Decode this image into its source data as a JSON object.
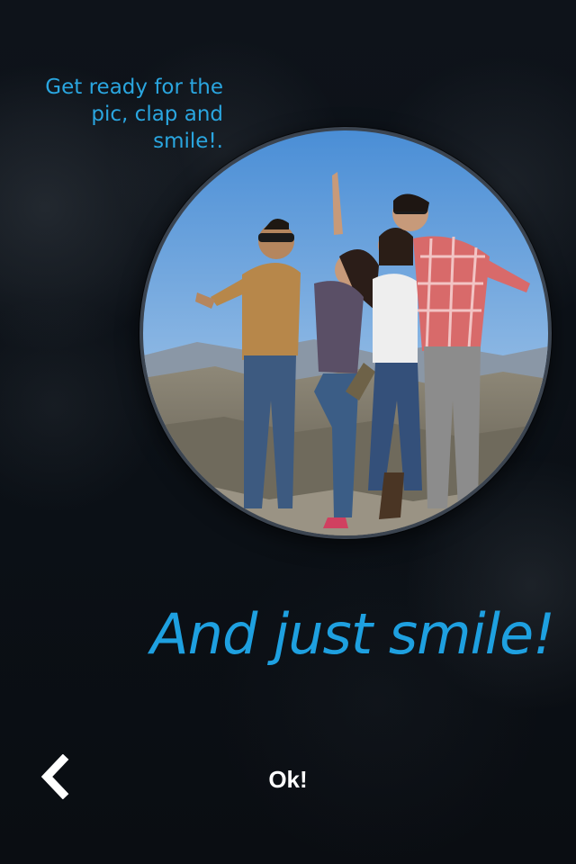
{
  "instruction": {
    "text": "Get ready for the\npic, clap and\nsmile!."
  },
  "photo": {
    "description_icon": "group-photo-image"
  },
  "headline": {
    "text": "And just smile!"
  },
  "footer": {
    "back_icon": "chevron-left-icon",
    "ok_label": "Ok!"
  },
  "colors": {
    "accent": "#1ea0e0",
    "background": "#0b0f15",
    "button_text": "#ffffff"
  }
}
